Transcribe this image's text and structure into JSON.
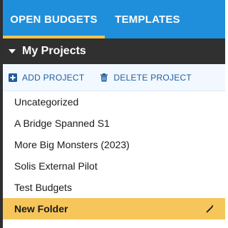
{
  "tabs": [
    {
      "label": "OPEN BUDGETS",
      "active": true
    },
    {
      "label": "TEMPLATES",
      "active": false
    }
  ],
  "project_section": {
    "title": "My Projects"
  },
  "actions": {
    "add_project": "ADD PROJECT",
    "delete_project": "DELETE PROJECT"
  },
  "projects": [
    "Uncategorized",
    "A Bridge Spanned S1",
    "More Big Monsters (2023)",
    "Solis External Pilot",
    "Test Budgets",
    "New Folder"
  ],
  "colors": {
    "accent": "#1f8fdb",
    "tab_indicator": "#f4c24d",
    "header_bg": "#303030",
    "selected_bg": "#f6c65a",
    "action_text": "#1f5d9e"
  },
  "icons": {
    "caret": "caret-down-icon",
    "add": "plus-square-icon",
    "delete": "trash-icon",
    "edit": "pencil-icon"
  }
}
